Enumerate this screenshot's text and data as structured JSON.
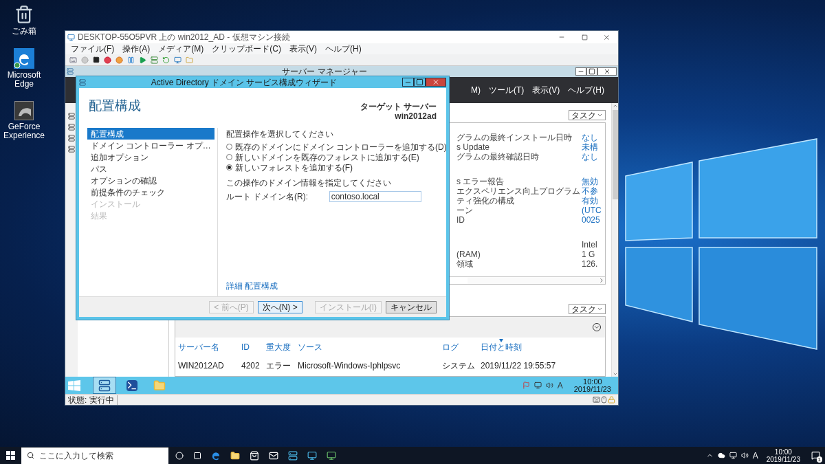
{
  "desktop_icons": [
    {
      "kind": "recycle",
      "label": "ごみ箱"
    },
    {
      "kind": "edge",
      "label": "Microsoft Edge"
    },
    {
      "kind": "geforce",
      "label": "GeForce Experience"
    }
  ],
  "vm_window": {
    "title": "DESKTOP-55O5PVR 上の win2012_AD - 仮想マシン接続",
    "menu": [
      "ファイル(F)",
      "操作(A)",
      "メディア(M)",
      "クリップボード(C)",
      "表示(V)",
      "ヘルプ(H)"
    ],
    "status": "状態: 実行中"
  },
  "server_manager": {
    "title": "サーバー マネージャー",
    "menu": [
      "M)",
      "ツール(T)",
      "表示(V)",
      "ヘルプ(H)"
    ],
    "properties": {
      "tasks_button": "タスク",
      "sections": [
        [
          {
            "label": "グラムの最終インストール日時",
            "value": "なし",
            "link": true
          },
          {
            "label": "s Update",
            "value": "未構",
            "link": true
          },
          {
            "label": "グラムの最終確認日時",
            "value": "なし",
            "link": true
          }
        ],
        [
          {
            "label": "s エラー報告",
            "value": "無効",
            "link": true
          },
          {
            "label": "エクスペリエンス向上プログラム",
            "value": "不参",
            "link": true
          },
          {
            "label": "ティ強化の構成",
            "value": "有効",
            "link": true
          },
          {
            "label": "ーン",
            "value": "(UTC",
            "link": true
          },
          {
            "label": "ID",
            "value": "0025",
            "link": true
          }
        ],
        [
          {
            "value": "Intel",
            "link": false
          },
          {
            "label": "(RAM)",
            "value": "1 G",
            "link": false
          },
          {
            "label": "領域",
            "value": "126.",
            "link": false
          }
        ]
      ]
    },
    "events": {
      "tasks_button": "タスク",
      "columns": [
        {
          "label": "サーバー名",
          "sorted": false
        },
        {
          "label": "ID",
          "sorted": false
        },
        {
          "label": "重大度",
          "sorted": false
        },
        {
          "label": "ソース",
          "sorted": false
        },
        {
          "label": "ログ",
          "sorted": false
        },
        {
          "label": "日付と時刻",
          "sorted": true
        }
      ],
      "rows": [
        [
          "WIN2012AD",
          "4202",
          "エラー",
          "Microsoft-Windows-Iphlpsvc",
          "システム",
          "2019/11/22 19:55:57"
        ]
      ]
    },
    "taskbar": {
      "apps": [
        {
          "kind": "server-manager",
          "selected": true
        },
        {
          "kind": "powershell",
          "selected": false
        },
        {
          "kind": "explorer",
          "selected": false
        }
      ],
      "ime": "A",
      "time": "10:00",
      "date": "2019/11/23"
    }
  },
  "wizard": {
    "title": "Active Directory ドメイン サービス構成ウィザード",
    "heading": "配置構成",
    "target_label": "ターゲット サーバー",
    "target_server": "win2012ad",
    "nav": [
      {
        "label": "配置構成",
        "selected": true,
        "disabled": false
      },
      {
        "label": "ドメイン コントローラー オプ…",
        "selected": false,
        "disabled": false
      },
      {
        "label": "追加オプション",
        "selected": false,
        "disabled": false
      },
      {
        "label": "パス",
        "selected": false,
        "disabled": false
      },
      {
        "label": "オプションの確認",
        "selected": false,
        "disabled": false
      },
      {
        "label": "前提条件のチェック",
        "selected": false,
        "disabled": false
      },
      {
        "label": "インストール",
        "selected": false,
        "disabled": true
      },
      {
        "label": "結果",
        "selected": false,
        "disabled": true
      }
    ],
    "prompt": "配置操作を選択してください",
    "options": [
      {
        "label": "既存のドメインにドメイン コントローラーを追加する(D)",
        "selected": false
      },
      {
        "label": "新しいドメインを既存のフォレストに追加する(E)",
        "selected": false
      },
      {
        "label": "新しいフォレストを追加する(F)",
        "selected": true
      }
    ],
    "domain_prompt": "この操作のドメイン情報を指定してください",
    "domain_label": "ルート ドメイン名(R):",
    "domain_value": "contoso.local",
    "more_link": "詳細 配置構成",
    "buttons": [
      {
        "label": "< 前へ(P)",
        "disabled": true,
        "focused": false
      },
      {
        "label": "次へ(N) >",
        "disabled": false,
        "focused": true
      },
      {
        "label": "インストール(I)",
        "disabled": true,
        "focused": false
      },
      {
        "label": "キャンセル",
        "disabled": false,
        "focused": false
      }
    ]
  },
  "taskbar": {
    "search": {
      "placeholder": "ここに入力して検索"
    },
    "ime": "A",
    "time": "10:00",
    "date": "2019/11/23",
    "notification_count": "1"
  }
}
